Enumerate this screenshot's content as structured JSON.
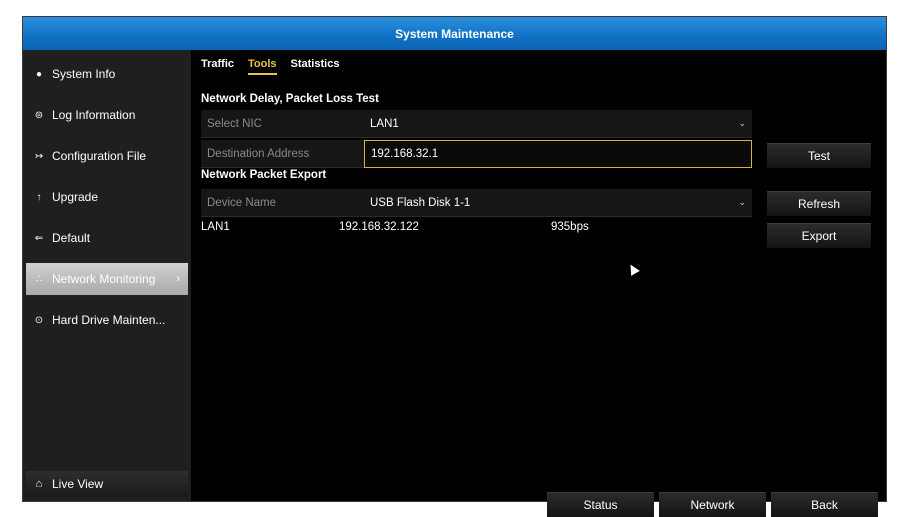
{
  "window": {
    "title": "System Maintenance"
  },
  "sidebar": {
    "items": [
      {
        "icon": "info-icon",
        "glyph": "●",
        "label": "System Info"
      },
      {
        "icon": "log-icon",
        "glyph": "⊜",
        "label": "Log Information"
      },
      {
        "icon": "config-file-icon",
        "glyph": "↣",
        "label": "Configuration File"
      },
      {
        "icon": "upgrade-icon",
        "glyph": "↑",
        "label": "Upgrade"
      },
      {
        "icon": "default-icon",
        "glyph": "⇐",
        "label": "Default"
      },
      {
        "icon": "network-monitor-icon",
        "glyph": "∴",
        "label": "Network Monitoring",
        "active": true
      },
      {
        "icon": "hard-drive-icon",
        "glyph": "⊙",
        "label": "Hard Drive Mainten..."
      }
    ],
    "live_view": {
      "icon": "home-icon",
      "glyph": "⌂",
      "label": "Live View"
    }
  },
  "tabs": [
    {
      "label": "Traffic"
    },
    {
      "label": "Tools",
      "active": true
    },
    {
      "label": "Statistics"
    }
  ],
  "delay_test": {
    "title": "Network Delay, Packet Loss Test",
    "select_nic_label": "Select NIC",
    "select_nic_value": "LAN1",
    "destination_label": "Destination Address",
    "destination_value": "192.168.32.1",
    "test_button": "Test"
  },
  "packet_export": {
    "title": "Network Packet Export",
    "device_label": "Device Name",
    "device_value": "USB Flash Disk 1-1",
    "refresh_button": "Refresh",
    "export_button": "Export",
    "nic": "LAN1",
    "ip": "192.168.32.122",
    "rate": "935bps"
  },
  "footer": {
    "status_button": "Status",
    "network_button": "Network",
    "back_button": "Back"
  },
  "colors": {
    "title_bar": "#1273c7",
    "tab_active": "#e8c34a",
    "active_item": "#bdbdbd"
  }
}
